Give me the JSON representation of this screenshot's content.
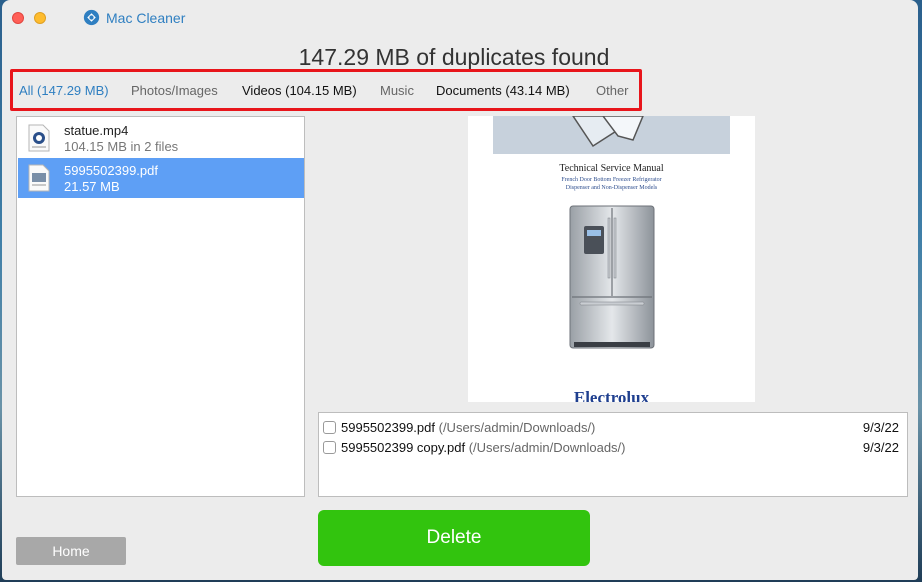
{
  "app": {
    "title": "Mac Cleaner"
  },
  "headline": "147.29 MB of duplicates found",
  "tabs": [
    {
      "label": "All (147.29 MB)"
    },
    {
      "label": "Photos/Images"
    },
    {
      "label": "Videos (104.15 MB)"
    },
    {
      "label": "Music"
    },
    {
      "label": "Documents (43.14 MB)"
    },
    {
      "label": "Other"
    }
  ],
  "files": [
    {
      "name": "statue.mp4",
      "detail": "104.15 MB in 2 files",
      "selected": false
    },
    {
      "name": "5995502399.pdf",
      "detail": "21.57 MB",
      "selected": true
    }
  ],
  "preview": {
    "title": "Technical Service Manual",
    "subtitle_line1": "French Door Bottom Freezer Refrigerator",
    "subtitle_line2": "Dispenser and Non-Dispenser Models",
    "brand": "Electrolux"
  },
  "duplicates": [
    {
      "name": "5995502399.pdf",
      "path": "(/Users/admin/Downloads/)",
      "date": "9/3/22",
      "checked": false
    },
    {
      "name": "5995502399 copy.pdf",
      "path": "(/Users/admin/Downloads/)",
      "date": "9/3/22",
      "checked": false
    }
  ],
  "buttons": {
    "delete": "Delete",
    "home": "Home"
  },
  "colors": {
    "accent": "#2f7fc1",
    "selection": "#5e9ff5",
    "delete": "#32c40e",
    "highlight_border": "#e8151b"
  }
}
